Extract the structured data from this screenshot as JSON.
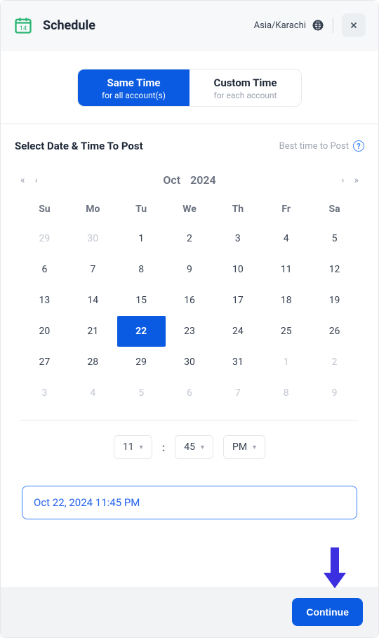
{
  "header": {
    "title": "Schedule",
    "timezone": "Asia/Karachi"
  },
  "toggle": {
    "same": {
      "title": "Same Time",
      "subtitle": "for all account(s)"
    },
    "custom": {
      "title": "Custom Time",
      "subtitle": "for each account"
    },
    "active": "same"
  },
  "section": {
    "label": "Select Date & Time To Post",
    "best": "Best time to Post"
  },
  "calendar": {
    "month": "Oct",
    "year": "2024",
    "dow": [
      "Su",
      "Mo",
      "Tu",
      "We",
      "Th",
      "Fr",
      "Sa"
    ],
    "weeks": [
      [
        {
          "d": "29",
          "o": true
        },
        {
          "d": "30",
          "o": true
        },
        {
          "d": "1"
        },
        {
          "d": "2"
        },
        {
          "d": "3"
        },
        {
          "d": "4"
        },
        {
          "d": "5"
        }
      ],
      [
        {
          "d": "6"
        },
        {
          "d": "7"
        },
        {
          "d": "8"
        },
        {
          "d": "9"
        },
        {
          "d": "10"
        },
        {
          "d": "11"
        },
        {
          "d": "12"
        }
      ],
      [
        {
          "d": "13"
        },
        {
          "d": "14"
        },
        {
          "d": "15"
        },
        {
          "d": "16"
        },
        {
          "d": "17"
        },
        {
          "d": "18"
        },
        {
          "d": "19"
        }
      ],
      [
        {
          "d": "20"
        },
        {
          "d": "21"
        },
        {
          "d": "22",
          "sel": true
        },
        {
          "d": "23"
        },
        {
          "d": "24"
        },
        {
          "d": "25"
        },
        {
          "d": "26"
        }
      ],
      [
        {
          "d": "27"
        },
        {
          "d": "28"
        },
        {
          "d": "29"
        },
        {
          "d": "30"
        },
        {
          "d": "31"
        },
        {
          "d": "1",
          "o": true
        },
        {
          "d": "2",
          "o": true
        }
      ],
      [
        {
          "d": "3",
          "o": true
        },
        {
          "d": "4",
          "o": true
        },
        {
          "d": "5",
          "o": true
        },
        {
          "d": "6",
          "o": true
        },
        {
          "d": "7",
          "o": true
        },
        {
          "d": "8",
          "o": true
        },
        {
          "d": "9",
          "o": true
        }
      ]
    ]
  },
  "time": {
    "hour": "11",
    "minute": "45",
    "ampm": "PM",
    "colon": ":"
  },
  "selected_display": "Oct 22, 2024 11:45 PM",
  "footer": {
    "continue": "Continue"
  },
  "colors": {
    "primary": "#0a5be1"
  }
}
